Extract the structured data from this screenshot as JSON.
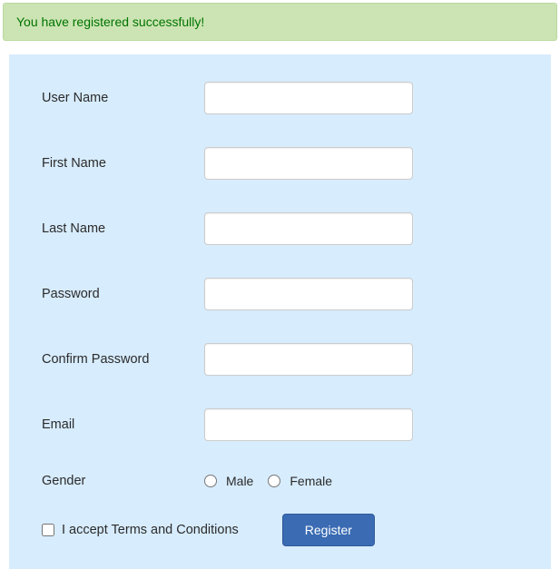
{
  "alert": {
    "message": "You have registered successfully!"
  },
  "form": {
    "fields": {
      "username": {
        "label": "User Name",
        "value": ""
      },
      "firstname": {
        "label": "First Name",
        "value": ""
      },
      "lastname": {
        "label": "Last Name",
        "value": ""
      },
      "password": {
        "label": "Password",
        "value": ""
      },
      "confirm_password": {
        "label": "Confirm Password",
        "value": ""
      },
      "email": {
        "label": "Email",
        "value": ""
      }
    },
    "gender": {
      "label": "Gender",
      "options": {
        "male": "Male",
        "female": "Female"
      }
    },
    "terms": {
      "label": "I accept Terms and Conditions"
    },
    "submit": {
      "label": "Register"
    }
  }
}
